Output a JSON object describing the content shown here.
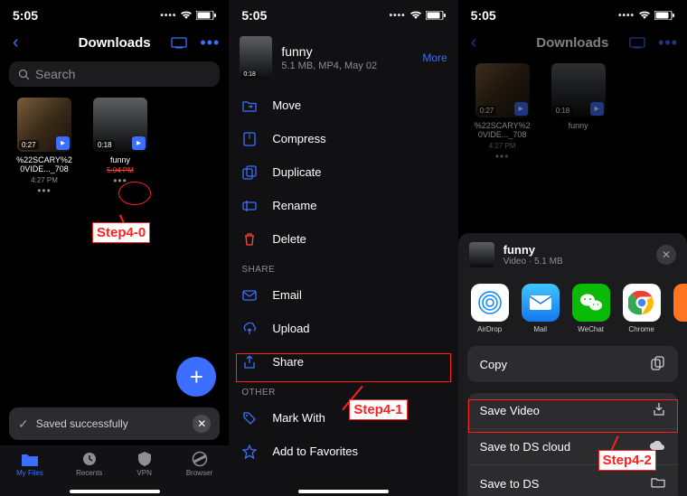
{
  "status": {
    "time": "5:05"
  },
  "screen1": {
    "title": "Downloads",
    "searchPlaceholder": "Search",
    "files": [
      {
        "name": "%22SCARY%20VIDE..._708",
        "time": "4:27 PM",
        "duration": "0:27"
      },
      {
        "name": "funny",
        "time": "5:04 PM",
        "duration": "0:18"
      }
    ],
    "fab": "+",
    "toast": "Saved successfully",
    "tabs": {
      "myfiles": "My Files",
      "recents": "Recents",
      "vpn": "VPN",
      "browser": "Browser"
    },
    "annotation": "Step4-0"
  },
  "screen2": {
    "file": {
      "name": "funny",
      "meta": "5.1 MB, MP4, May 02",
      "more": "More",
      "duration": "0:18"
    },
    "items": {
      "move": "Move",
      "compress": "Compress",
      "duplicate": "Duplicate",
      "rename": "Rename",
      "delete": "Delete",
      "email": "Email",
      "upload": "Upload",
      "share": "Share",
      "markwith": "Mark With",
      "addfav": "Add to Favorites"
    },
    "sections": {
      "share": "SHARE",
      "other": "OTHER"
    },
    "annotation": "Step4-1"
  },
  "screen3": {
    "title": "Downloads",
    "files": [
      {
        "name": "%22SCARY%20VIDE..._708",
        "time": "4:27 PM",
        "duration": "0:27"
      },
      {
        "name": "funny",
        "time": "",
        "duration": "0:18"
      }
    ],
    "sheet": {
      "name": "funny",
      "sub": "Video · 5.1 MB",
      "apps": {
        "airdrop": "AirDrop",
        "mail": "Mail",
        "wechat": "WeChat",
        "chrome": "Chrome"
      },
      "copy": "Copy",
      "savevideo": "Save Video",
      "savedscloud": "Save to DS cloud",
      "saveds": "Save to DS"
    },
    "annotation": "Step4-2"
  }
}
